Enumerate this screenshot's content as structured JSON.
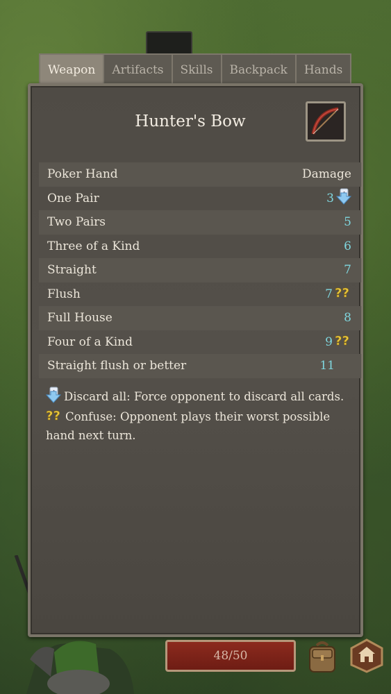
{
  "tabs": [
    "Weapon",
    "Artifacts",
    "Skills",
    "Backpack",
    "Hands"
  ],
  "active_tab": "Weapon",
  "weapon": {
    "name": "Hunter's Bow",
    "icon": "bow-icon"
  },
  "table": {
    "header": {
      "hand": "Poker Hand",
      "damage": "Damage"
    },
    "rows": [
      {
        "hand": "One Pair",
        "damage": "3",
        "effect": "discard-all-icon"
      },
      {
        "hand": "Two Pairs",
        "damage": "5",
        "effect": ""
      },
      {
        "hand": "Three of a Kind",
        "damage": "6",
        "effect": ""
      },
      {
        "hand": "Straight",
        "damage": "7",
        "effect": ""
      },
      {
        "hand": "Flush",
        "damage": "7",
        "effect": "confuse-icon"
      },
      {
        "hand": "Full House",
        "damage": "8",
        "effect": ""
      },
      {
        "hand": "Four of a Kind",
        "damage": "9",
        "effect": "confuse-icon"
      },
      {
        "hand": "Straight flush or better",
        "damage": "11",
        "effect": ""
      }
    ]
  },
  "descriptions": [
    {
      "icon": "discard-all-icon",
      "text": "Discard all: Force opponent to discard all cards."
    },
    {
      "icon": "confuse-icon",
      "text": "Confuse: Opponent plays their worst possible hand next turn."
    }
  ],
  "bottom": {
    "health": "48/50",
    "backpack_icon": "backpack-icon",
    "home_icon": "home-icon"
  },
  "colors": {
    "damage_value": "#7fd6de",
    "panel_bg": "#4f4b45",
    "health_bar": "#8c2a1e"
  }
}
